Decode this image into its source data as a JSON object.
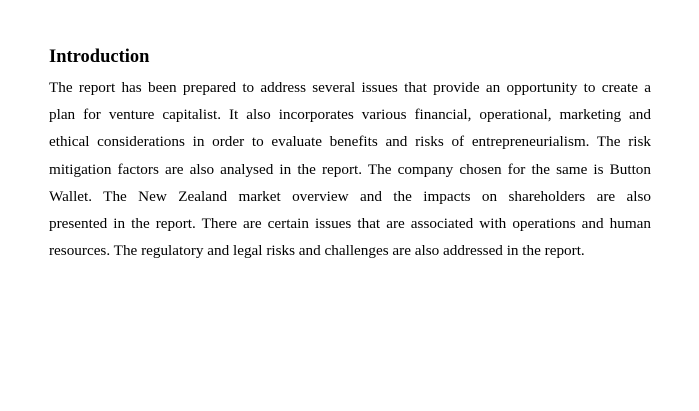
{
  "document": {
    "heading": "Introduction",
    "paragraph_lines": [
      "The report has been prepared to address several issues that provide an opportunity to create a",
      "plan for venture capitalist. It also incorporates various financial, operational, marketing and",
      "ethical considerations in order to evaluate benefits and risks of entrepreneurialism. The risk",
      "mitigation factors are also analysed in the report. The company chosen for the same is Button",
      "Wallet. The New Zealand market overview and the impacts on shareholders are also",
      "presented in the report. There are certain issues that are associated with operations and human",
      "resources. The regulatory and legal risks and challenges are also addressed in the report."
    ]
  },
  "colors": {
    "background": "#ffffff",
    "text": "#000000"
  }
}
